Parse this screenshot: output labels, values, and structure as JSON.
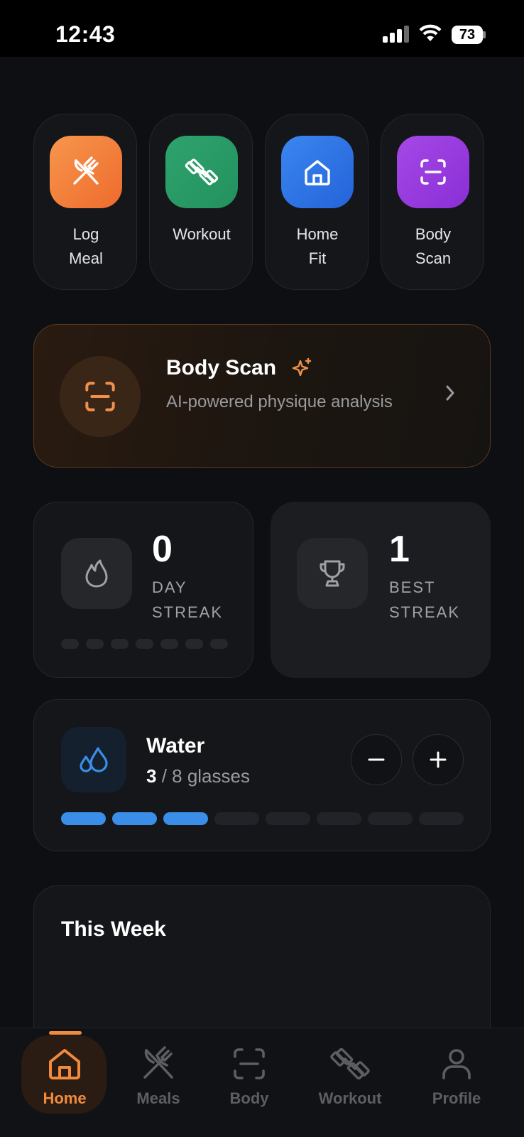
{
  "status_bar": {
    "time": "12:43",
    "battery": "73"
  },
  "quick_actions": [
    {
      "id": "log-meal",
      "label": "Log\nMeal",
      "color_from": "#f7964e",
      "color_to": "#ee6b2c",
      "icon": "fork-knife-icon"
    },
    {
      "id": "workout",
      "label": "Workout",
      "color_from": "#2ea36e",
      "color_to": "#23915e",
      "icon": "dumbbell-icon"
    },
    {
      "id": "home-fit",
      "label": "Home\nFit",
      "color_from": "#3a86f0",
      "color_to": "#2563d9",
      "icon": "house-icon"
    },
    {
      "id": "body-scan",
      "label": "Body\nScan",
      "color_from": "#a548e6",
      "color_to": "#8a2fd6",
      "icon": "scan-icon"
    }
  ],
  "banner": {
    "title": "Body Scan",
    "subtitle": "AI-powered physique analysis",
    "icon": "scan-icon",
    "accent": "#f0914a"
  },
  "streaks": {
    "day": {
      "value": "0",
      "label": "DAY\nSTREAK",
      "icon": "flame-icon"
    },
    "best": {
      "value": "1",
      "label": "BEST\nSTREAK",
      "icon": "trophy-icon"
    },
    "week_progress": [
      false,
      false,
      false,
      false,
      false,
      false,
      false
    ]
  },
  "water": {
    "title": "Water",
    "current": "3",
    "goal_text": " / 8 glasses",
    "filled": 3,
    "total": 8,
    "accent": "#3a8ee8"
  },
  "week": {
    "title": "This Week"
  },
  "nav": {
    "active": "home",
    "accent": "#f28a3e",
    "items": [
      {
        "id": "home",
        "label": "Home"
      },
      {
        "id": "meals",
        "label": "Meals"
      },
      {
        "id": "body",
        "label": "Body"
      },
      {
        "id": "workout",
        "label": "Workout"
      },
      {
        "id": "profile",
        "label": "Profile"
      }
    ]
  }
}
